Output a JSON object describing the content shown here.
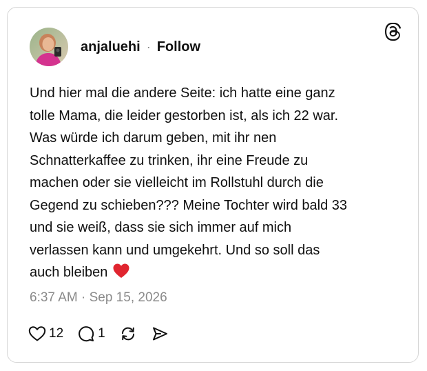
{
  "post": {
    "author": {
      "username": "anjaluehi",
      "separator": "·",
      "follow_label": "Follow"
    },
    "text": "Und hier mal die andere Seite: ich hatte eine ganz\ntolle Mama, die leider gestorben ist, als ich 22 war.\nWas würde ich darum geben, mit ihr nen\nSchnatterkaffee zu trinken, ihr eine Freude zu\nmachen oder sie vielleicht im Rollstuhl durch die\nGegend zu schieben??? Meine Tochter wird bald 33\nund sie weiß, dass sie sich immer auf mich\nverlassen kann und umgekehrt. Und so soll das\nauch bleiben",
    "emoji": "red-heart",
    "timestamp": "6:37 AM · Sep 15, 2026",
    "likes_count": "12",
    "replies_count": "1"
  },
  "icons": {
    "brand": "threads-logo-icon",
    "like": "heart-outline-icon",
    "reply": "speech-bubble-icon",
    "repost": "repost-arrows-icon",
    "share": "send-paper-plane-icon"
  },
  "colors": {
    "text": "#101010",
    "muted": "#8a8a8a",
    "border": "#d6d6d6",
    "heart_emoji": "#e0252f"
  }
}
